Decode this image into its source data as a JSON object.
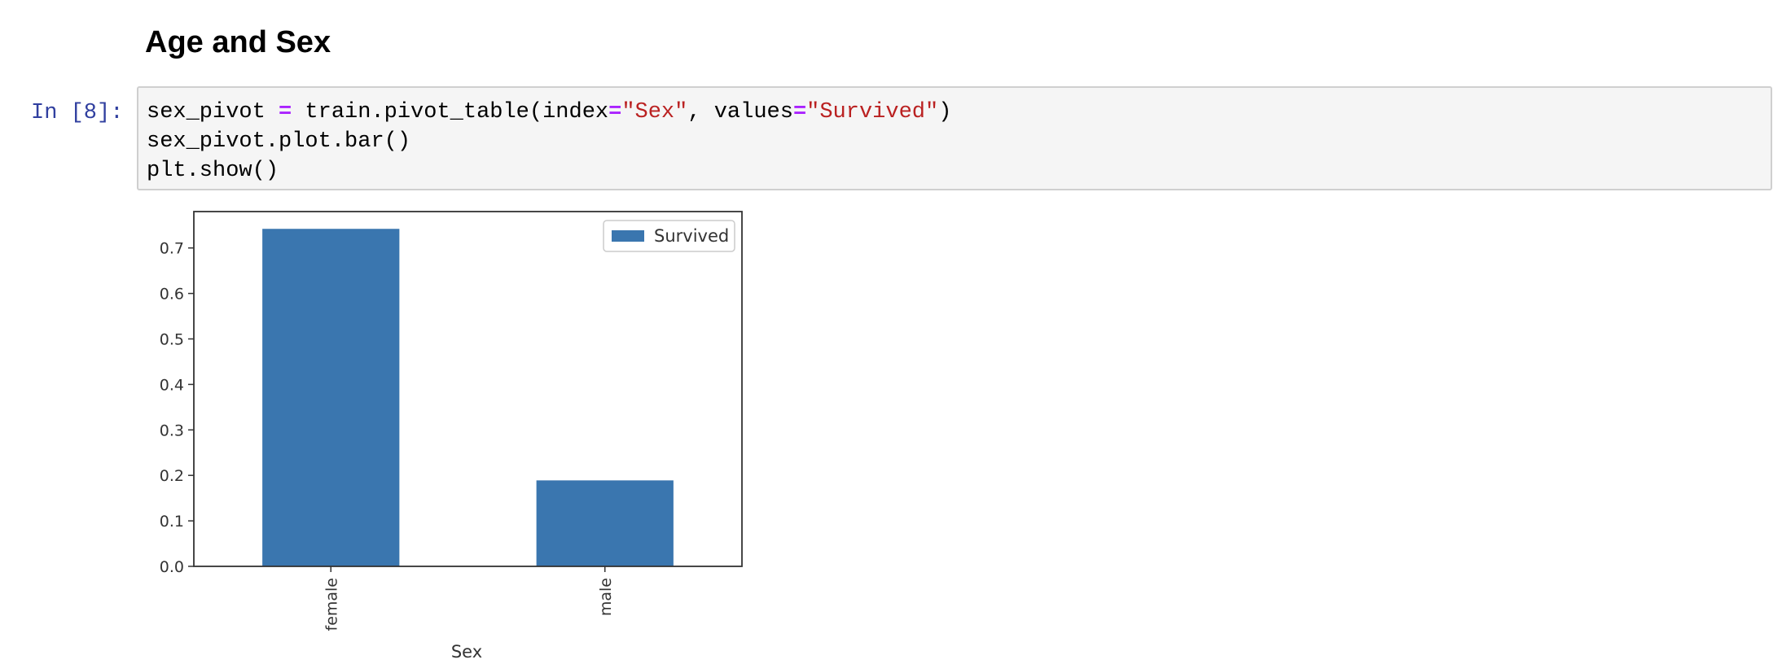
{
  "section": {
    "heading": "Age and Sex"
  },
  "cell": {
    "prompt": "In [8]:",
    "code": {
      "line1": {
        "var": "sex_pivot ",
        "eq1": "=",
        "call": " train.pivot_table(index",
        "eq2": "=",
        "str1": "\"Sex\"",
        "mid": ", values",
        "eq3": "=",
        "str2": "\"Survived\"",
        "end": ")"
      },
      "line2": "sex_pivot.plot.bar()",
      "line3": "plt.show()"
    }
  },
  "colors": {
    "bar": "#3a76af",
    "prompt": "#303f9f",
    "operator": "#aa22ff",
    "string": "#ba2121",
    "cell_background": "#f5f5f5"
  },
  "chart_data": {
    "type": "bar",
    "categories": [
      "female",
      "male"
    ],
    "series": [
      {
        "name": "Survived",
        "values": [
          0.742,
          0.189
        ]
      }
    ],
    "xlabel": "Sex",
    "ylabel": "",
    "ylim": [
      0,
      0.78
    ],
    "yticks": [
      0.0,
      0.1,
      0.2,
      0.3,
      0.4,
      0.5,
      0.6,
      0.7
    ],
    "ytick_labels": [
      "0.0",
      "0.1",
      "0.2",
      "0.3",
      "0.4",
      "0.5",
      "0.6",
      "0.7"
    ],
    "xtick_rotation": "vertical",
    "grid": false,
    "legend": "top-right"
  }
}
